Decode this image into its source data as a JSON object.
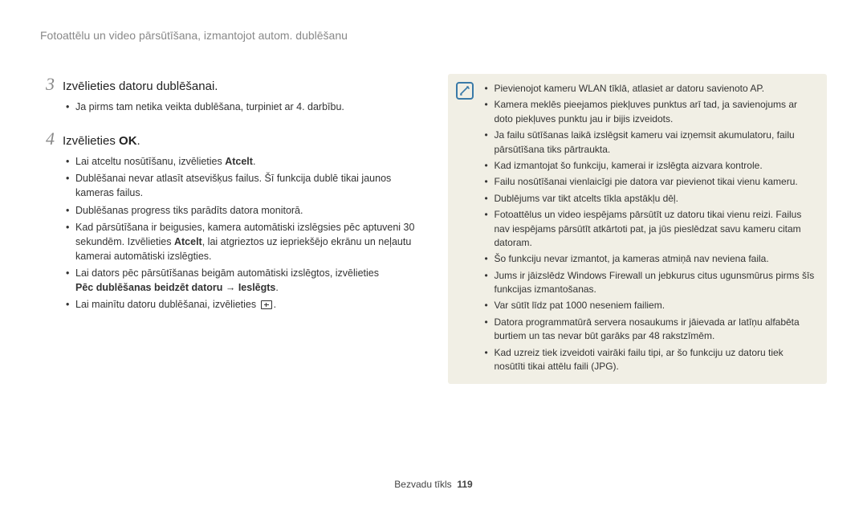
{
  "header": "Fotoattēlu un video pārsūtīšana, izmantojot autom. dublēšanu",
  "steps": [
    {
      "num": "3",
      "text": "Izvēlieties datoru dublēšanai.",
      "bullets": [
        {
          "text": "Ja pirms tam netika veikta dublēšana, turpiniet ar 4. darbību."
        }
      ]
    },
    {
      "num": "4",
      "text_prefix": "Izvēlieties ",
      "text_bold": "OK",
      "text_suffix": ".",
      "bullets": [
        {
          "prefix": "Lai atceltu nosūtīšanu, izvēlieties ",
          "bold": "Atcelt",
          "suffix": "."
        },
        {
          "text": "Dublēšanai nevar atlasīt atsevišķus failus. Šī funkcija dublē tikai jaunos kameras failus."
        },
        {
          "text": "Dublēšanas progress tiks parādīts datora monitorā."
        },
        {
          "prefix": "Kad pārsūtīšana ir beigusies, kamera automātiski izslēgsies pēc aptuveni 30 sekundēm. Izvēlieties ",
          "bold": "Atcelt",
          "suffix": ", lai atgrieztos uz iepriekšējo ekrānu un neļautu kamerai automātiski izslēgties."
        },
        {
          "prefix": "Lai dators pēc pārsūtīšanas beigām automātiski izslēgtos, izvēlieties ",
          "bold2": "Pēc dublēšanas beidzēt datoru → Ieslēgts",
          "suffix2": "."
        },
        {
          "text_icon": "Lai mainītu datoru dublēšanai, izvēlieties "
        }
      ]
    }
  ],
  "info": [
    "Pievienojot kameru WLAN tīklā, atlasiet ar datoru savienoto AP.",
    "Kamera meklēs pieejamos piekļuves punktus arī tad, ja savienojums ar doto piekļuves punktu jau ir bijis izveidots.",
    "Ja failu sūtīšanas laikā izslēgsit kameru vai izņemsit akumulatoru, failu pārsūtīšana tiks pārtraukta.",
    "Kad izmantojat šo funkciju, kamerai ir izslēgta aizvara kontrole.",
    "Failu nosūtīšanai vienlaicīgi pie datora var pievienot tikai vienu kameru.",
    "Dublējums var tikt atcelts tīkla apstākļu dēļ.",
    "Fotoattēlus un video iespējams pārsūtīt uz datoru tikai vienu reizi. Failus nav iespējams pārsūtīt atkārtoti pat, ja jūs pieslēdzat savu kameru citam datoram.",
    "Šo funkciju nevar izmantot, ja kameras atmiņā nav neviena faila.",
    "Jums ir jāizslēdz Windows Firewall un jebkurus citus ugunsmūrus pirms šīs funkcijas izmantošanas.",
    "Var sūtīt līdz pat 1000 neseniem failiem.",
    "Datora programmatūrā servera nosaukums ir jāievada ar latīņu alfabēta burtiem un tas nevar būt garāks par 48 rakstzīmēm.",
    "Kad uzreiz tiek izveidoti vairāki failu tipi, ar šo funkciju uz datoru tiek nosūtīti tikai attēlu faili (JPG)."
  ],
  "footer_section": "Bezvadu tīkls",
  "footer_page": "119"
}
